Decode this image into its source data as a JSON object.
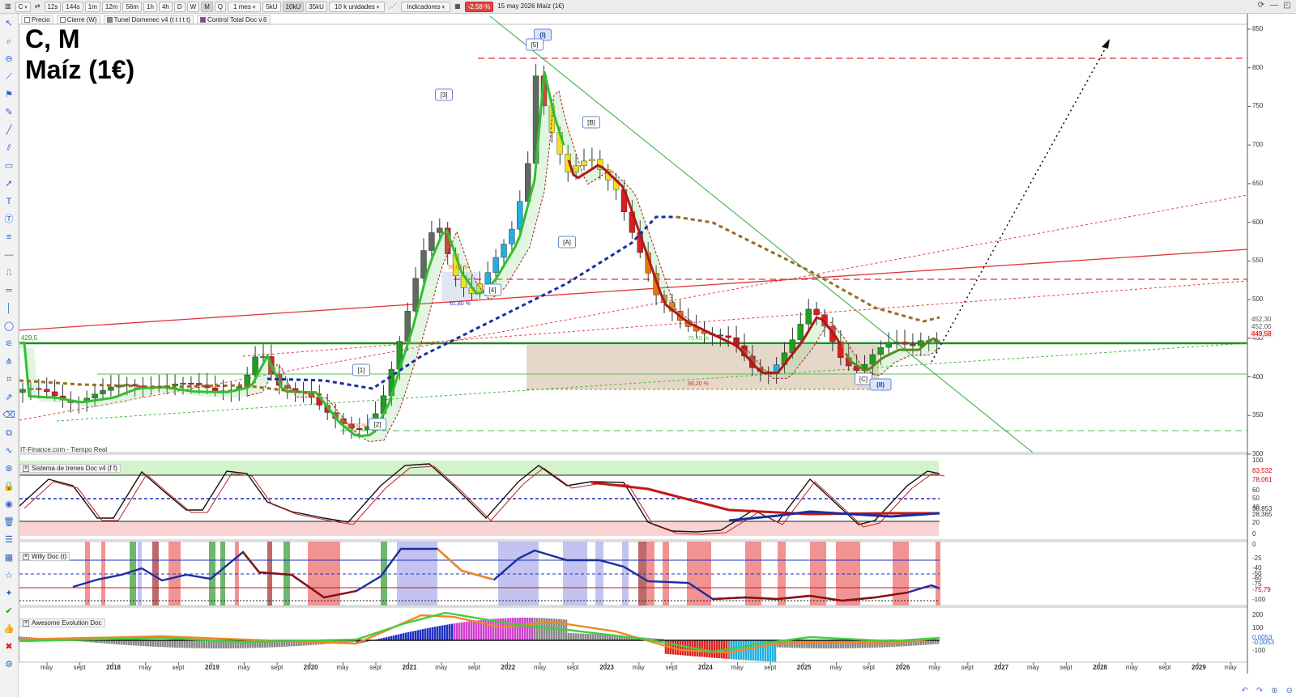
{
  "toolbar": {
    "symbol": "C",
    "periods": [
      "12s",
      "144s",
      "1m",
      "12m",
      "56m",
      "1h",
      "4h",
      "D",
      "W",
      "M",
      "Q"
    ],
    "active_period": "M",
    "range": "1 mes",
    "units": [
      "5kU",
      "10kU",
      "35kU"
    ],
    "active_unit": "10kU",
    "unit_count": "10 k unidades",
    "indicators_label": "Indicadores",
    "change_badge": "-2,58 %",
    "status": "15 may 2026  Maíz (1€)"
  },
  "legend": [
    {
      "label": "Precio",
      "color": "#ffffff"
    },
    {
      "label": "Cierre (W)",
      "color": "#ffffff"
    },
    {
      "label": "Tunel Domenec v4 (t t t t t)",
      "color": "#888888"
    },
    {
      "label": "Control Total Doc v.6",
      "color": "#9b3a8c"
    }
  ],
  "title": {
    "line1": "C, M",
    "line2": "Maíz (1€)"
  },
  "source": "IT-Finance.com - Tiempo Real",
  "main_axis": {
    "ticks": [
      "850",
      "800",
      "750",
      "700",
      "650",
      "600",
      "550",
      "500",
      "450",
      "400",
      "350",
      "300"
    ],
    "value_boxes": [
      {
        "text": "452,30",
        "bg": "#ffffff",
        "fg": "#555555"
      },
      {
        "text": "452,00",
        "bg": "#ffffff",
        "fg": "#555555"
      },
      {
        "text": "449,58",
        "bg": "#ffffff",
        "fg": "#cc0000"
      }
    ],
    "left_level": "429,5"
  },
  "annotations": {
    "wave_labels": [
      "(I)",
      "[5]",
      "[3]",
      "[B]",
      "[A]",
      "[4]",
      "[1]",
      "[2]",
      "[C]",
      "(II)"
    ],
    "fib_labels": [
      "61,80 %",
      "76,40 %",
      "88,20 %",
      "50,00 %",
      "38,20 %"
    ]
  },
  "panels": [
    {
      "title": "Sistema de trenes Doc v4 (f f)",
      "ticks": [
        "100",
        "83,532",
        "78,061",
        "60",
        "50",
        "40",
        "30,853",
        "28,365",
        "20",
        "0"
      ]
    },
    {
      "title": "Willy Doc (t)",
      "ticks": [
        "0",
        "-25",
        "-40",
        "-50",
        "-60",
        "-75",
        "-75,79",
        "-100"
      ]
    },
    {
      "title": "Awesome Evolution Doc",
      "ticks": [
        "200",
        "100",
        "0,0053",
        "-0,0053",
        "-100"
      ]
    }
  ],
  "time_axis": [
    "may",
    "sept",
    "2018",
    "may",
    "sept",
    "2019",
    "may",
    "sept",
    "2020",
    "may",
    "sept",
    "2021",
    "may",
    "sept",
    "2022",
    "may",
    "sept",
    "2023",
    "may",
    "sept",
    "2024",
    "may",
    "sept",
    "2025",
    "may",
    "sept",
    "2026",
    "may",
    "sept",
    "2027",
    "may",
    "sept",
    "2028",
    "may",
    "sept",
    "2029",
    "may"
  ],
  "colors": {
    "up": "#1f9e1f",
    "down": "#d62020",
    "accent": "#2a62c9"
  }
}
